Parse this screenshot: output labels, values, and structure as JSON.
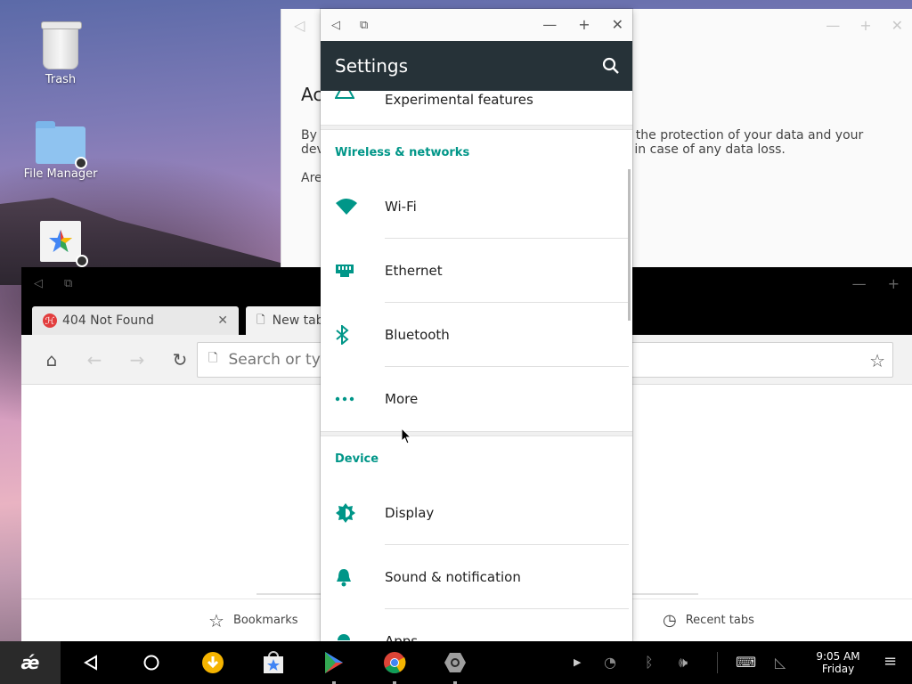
{
  "desktop": {
    "icons": [
      {
        "label": "Trash"
      },
      {
        "label": "File Manager"
      },
      {
        "label": ""
      }
    ]
  },
  "back_window": {
    "heading": "Ac",
    "left_lines": [
      "By a",
      "dev"
    ],
    "right_lines": [
      "e for the protection of your data and your",
      "vate in case of any data loss."
    ],
    "are_text": "Are"
  },
  "browser": {
    "tabs": [
      {
        "label": "404 Not Found"
      },
      {
        "label": "New tab"
      }
    ],
    "omnibox_placeholder": "Search or type URL",
    "bottom_links": {
      "bookmarks": "Bookmarks",
      "recent_tabs": "Recent tabs"
    }
  },
  "settings": {
    "title": "Settings",
    "partial_item": "Experimental features",
    "sections": [
      {
        "header": "Wireless & networks",
        "items": [
          {
            "label": "Wi-Fi",
            "icon": "wifi-icon"
          },
          {
            "label": "Ethernet",
            "icon": "ethernet-icon"
          },
          {
            "label": "Bluetooth",
            "icon": "bluetooth-icon"
          },
          {
            "label": "More",
            "icon": "more-icon"
          }
        ]
      },
      {
        "header": "Device",
        "items": [
          {
            "label": "Display",
            "icon": "brightness-icon"
          },
          {
            "label": "Sound & notification",
            "icon": "bell-icon"
          },
          {
            "label": "Apps",
            "icon": "android-icon"
          }
        ]
      }
    ],
    "accent_color": "#009688",
    "appbar_color": "#263238"
  },
  "taskbar": {
    "time": "9:05 AM",
    "day": "Friday"
  }
}
